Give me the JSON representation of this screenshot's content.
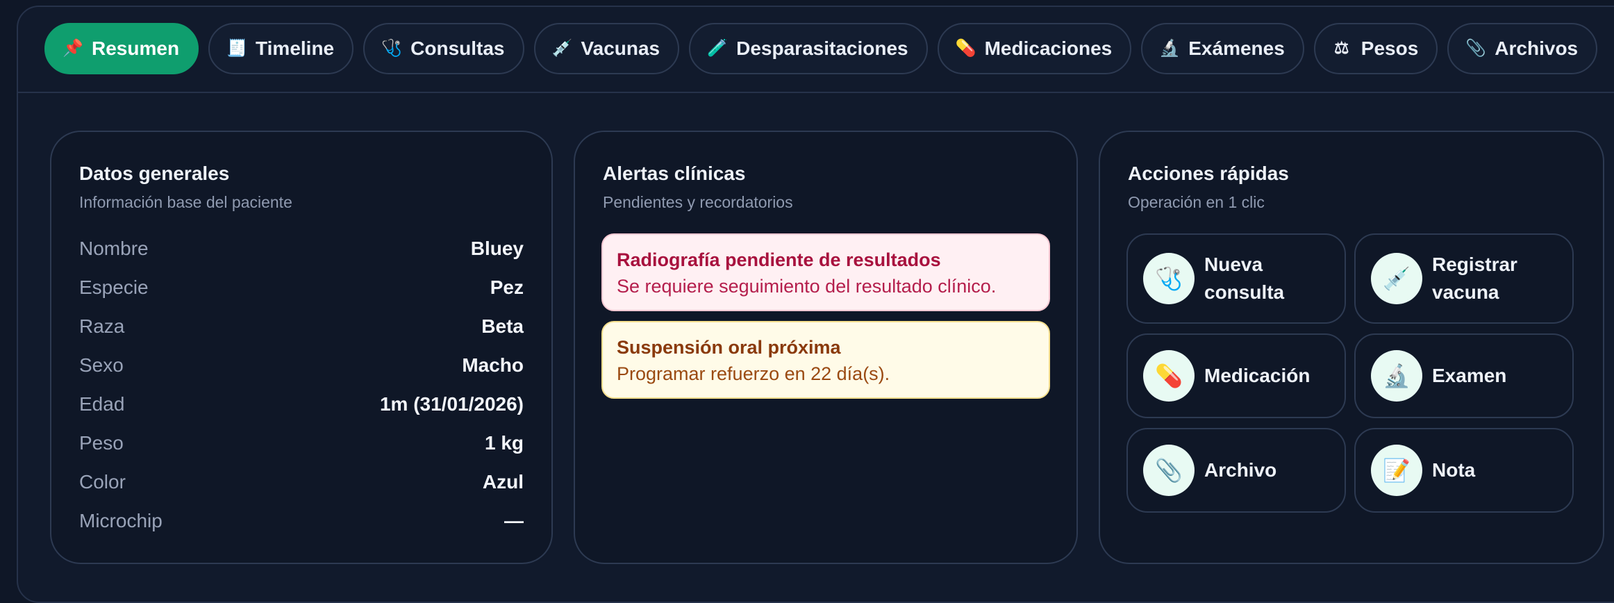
{
  "tabs": [
    {
      "label": "Resumen",
      "icon": "pushpin-icon",
      "glyph": "📌"
    },
    {
      "label": "Timeline",
      "icon": "receipt-icon",
      "glyph": "🧾"
    },
    {
      "label": "Consultas",
      "icon": "stethoscope-icon",
      "glyph": "🩺"
    },
    {
      "label": "Vacunas",
      "icon": "syringe-icon",
      "glyph": "💉"
    },
    {
      "label": "Desparasitaciones",
      "icon": "test-tube-icon",
      "glyph": "🧪"
    },
    {
      "label": "Medicaciones",
      "icon": "pill-icon",
      "glyph": "💊"
    },
    {
      "label": "Exámenes",
      "icon": "microscope-icon",
      "glyph": "🔬"
    },
    {
      "label": "Pesos",
      "icon": "scale-icon",
      "glyph": "⚖"
    },
    {
      "label": "Archivos",
      "icon": "paperclip-icon",
      "glyph": "📎"
    }
  ],
  "active_tab": "Resumen",
  "general": {
    "title": "Datos generales",
    "subtitle": "Información base del paciente",
    "rows": [
      {
        "label": "Nombre",
        "value": "Bluey"
      },
      {
        "label": "Especie",
        "value": "Pez"
      },
      {
        "label": "Raza",
        "value": "Beta"
      },
      {
        "label": "Sexo",
        "value": "Macho"
      },
      {
        "label": "Edad",
        "value": "1m (31/01/2026)"
      },
      {
        "label": "Peso",
        "value": "1 kg"
      },
      {
        "label": "Color",
        "value": "Azul"
      },
      {
        "label": "Microchip",
        "value": "—"
      }
    ]
  },
  "alerts": {
    "title": "Alertas clínicas",
    "subtitle": "Pendientes y recordatorios",
    "items": [
      {
        "title": "Radiografía pendiente de resultados",
        "detail": "Se requiere seguimiento del resultado clínico.",
        "level": "danger"
      },
      {
        "title": "Suspensión oral próxima",
        "detail": "Programar refuerzo en 22 día(s).",
        "level": "warning"
      }
    ]
  },
  "quick": {
    "title": "Acciones rápidas",
    "subtitle": "Operación en 1 clic",
    "actions": [
      {
        "label": "Nueva\nconsulta",
        "icon": "stethoscope-icon",
        "glyph": "🩺"
      },
      {
        "label": "Registrar\nvacuna",
        "icon": "syringe-icon",
        "glyph": "💉"
      },
      {
        "label": "Medicación",
        "icon": "pill-icon",
        "glyph": "💊"
      },
      {
        "label": "Examen",
        "icon": "microscope-icon",
        "glyph": "🔬"
      },
      {
        "label": "Archivo",
        "icon": "paperclip-icon",
        "glyph": "📎"
      },
      {
        "label": "Nota",
        "icon": "memo-icon",
        "glyph": "📝"
      }
    ]
  },
  "colors": {
    "accent": "#0f9e6e",
    "background": "#0f1727",
    "danger_bg": "#fff0f3",
    "warning_bg": "#fffbe8"
  }
}
